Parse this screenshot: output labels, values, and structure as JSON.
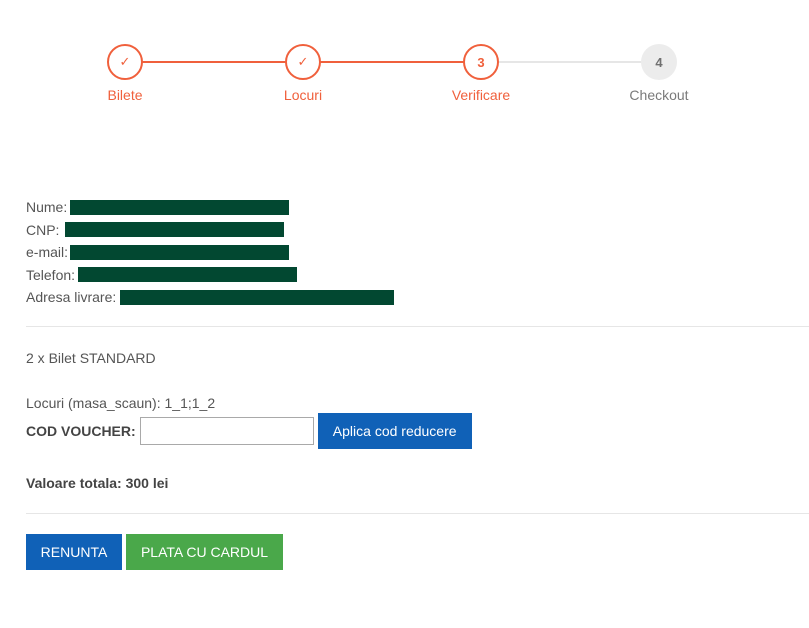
{
  "stepper": {
    "steps": [
      {
        "label": "Bilete",
        "marker": "✓",
        "state": "done"
      },
      {
        "label": "Locuri",
        "marker": "✓",
        "state": "done"
      },
      {
        "label": "Verificare",
        "marker": "3",
        "state": "current"
      },
      {
        "label": "Checkout",
        "marker": "4",
        "state": "pending"
      }
    ],
    "accent_color": "#f0603c",
    "pending_color": "#ececec"
  },
  "customer": {
    "name_label": "Nume:",
    "cnp_label": "CNP:",
    "email_label": "e-mail:",
    "phone_label": "Telefon:",
    "address_label": "Adresa livrare:",
    "redaction_color": "#024831"
  },
  "order": {
    "ticket_line": "2 x Bilet STANDARD",
    "seats_line": "Locuri (masa_scaun): 1_1;1_2",
    "voucher_label": "COD VOUCHER:",
    "voucher_value": "",
    "apply_button": "Aplica cod reducere",
    "total_line": "Valoare totala: 300 lei"
  },
  "actions": {
    "cancel_button": "RENUNTA",
    "pay_button": "PLATA CU CARDUL",
    "primary_color": "#1061b7",
    "success_color": "#4aa84a"
  }
}
